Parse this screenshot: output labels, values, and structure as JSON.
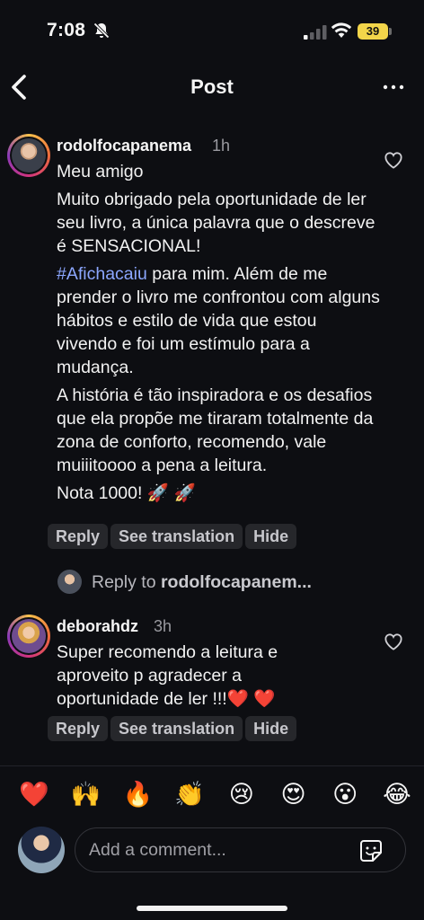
{
  "status_bar": {
    "time": "7:08",
    "battery": "39"
  },
  "header": {
    "title": "Post"
  },
  "comments": [
    {
      "username": "rodolfocapanema",
      "time": "1h",
      "paragraphs": [
        "Meu amigo",
        "Muito obrigado pela oportunidade de ler seu livro, a única palavra que o descreve é SENSACIONAL!",
        "para mim. Além de me prender o livro me confrontou com alguns hábitos e estilo de vida que estou vivendo e foi um estímulo para a mudança.",
        "A história é tão inspiradora e os desafios que ela propõe me tiraram totalmente da zona de conforto, recomendo, vale muiiitoooo a pena a leitura.",
        "Nota 1000! 🚀 🚀"
      ],
      "hashtag": "#Afichacaiu",
      "actions": {
        "reply": "Reply",
        "translate": "See translation",
        "hide": "Hide"
      }
    },
    {
      "username": "deborahdz",
      "time": "3h",
      "paragraphs": [
        "Super recomendo a leitura e aproveito p agradecer a oportunidade de ler !!!❤️ ❤️"
      ],
      "actions": {
        "reply": "Reply",
        "translate": "See translation",
        "hide": "Hide"
      }
    }
  ],
  "reply_prompt": {
    "prefix": "Reply to",
    "target": "rodolfocapanem..."
  },
  "emoji_bar": [
    "❤️",
    "🙌",
    "🔥",
    "👏",
    "😢",
    "😍",
    "😮",
    "😂"
  ],
  "composer": {
    "placeholder": "Add a comment..."
  }
}
